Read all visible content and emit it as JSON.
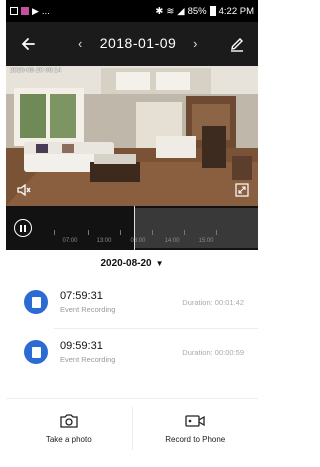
{
  "statusbar": {
    "left_text": "...",
    "battery": "85%",
    "time": "4:22 PM"
  },
  "header": {
    "date": "2018-01-09",
    "prev": "‹",
    "next": "›"
  },
  "video": {
    "watermark": "2020-08-20 09:14"
  },
  "timeline": {
    "ticks": [
      "07:00",
      "13:00",
      "08:00",
      "14:00",
      "15:00"
    ]
  },
  "list": {
    "date": "2020-08-20",
    "caret": "▼",
    "records": [
      {
        "time": "07:59:31",
        "type": "Event Recording",
        "duration": "Duration: 00:01:42"
      },
      {
        "time": "09:59:31",
        "type": "Event Recording",
        "duration": "Duration: 00:00:59"
      }
    ]
  },
  "actions": {
    "photo": "Take a photo",
    "record": "Record to Phone"
  },
  "colors": {
    "accent": "#2c6bd3",
    "header_bg": "#1b1b1b"
  }
}
